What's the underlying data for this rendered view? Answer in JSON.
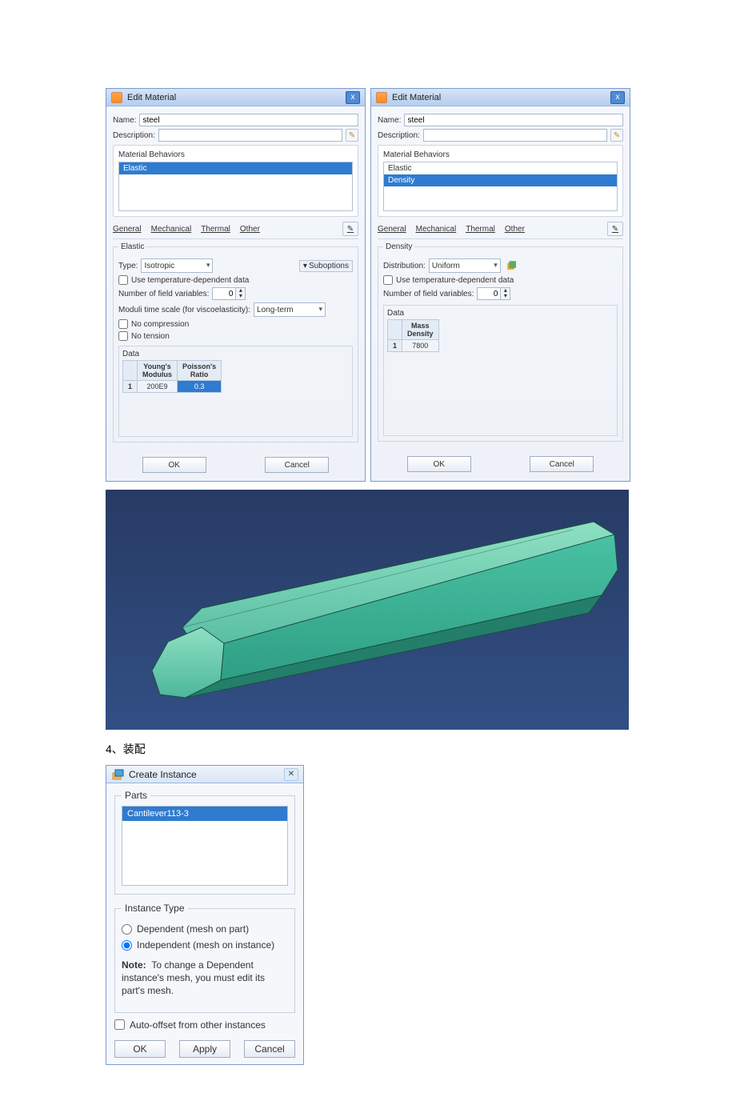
{
  "dlg_left": {
    "title": "Edit Material",
    "name_label": "Name:",
    "name_value": "steel",
    "desc_label": "Description:",
    "desc_value": "",
    "behaviors_label": "Material Behaviors",
    "behaviors": [
      "Elastic"
    ],
    "tabs": [
      "General",
      "Mechanical",
      "Thermal",
      "Other"
    ],
    "section_title": "Elastic",
    "type_label": "Type:",
    "type_value": "Isotropic",
    "suboptions_label": "Suboptions",
    "temp_dep_label": "Use temperature-dependent data",
    "field_vars_label": "Number of field variables:",
    "field_vars_value": "0",
    "moduli_label": "Moduli time scale (for viscoelasticity):",
    "moduli_value": "Long-term",
    "no_compression_label": "No compression",
    "no_tension_label": "No tension",
    "data_label": "Data",
    "table": {
      "headers": [
        "Young's\nModulus",
        "Poisson's\nRatio"
      ],
      "rows": [
        [
          "1",
          "200E9",
          "0.3"
        ]
      ]
    },
    "ok": "OK",
    "cancel": "Cancel"
  },
  "dlg_right": {
    "title": "Edit Material",
    "name_label": "Name:",
    "name_value": "steel",
    "desc_label": "Description:",
    "desc_value": "",
    "behaviors_label": "Material Behaviors",
    "behaviors": [
      "Elastic",
      "Density"
    ],
    "tabs": [
      "General",
      "Mechanical",
      "Thermal",
      "Other"
    ],
    "section_title": "Density",
    "dist_label": "Distribution:",
    "dist_value": "Uniform",
    "temp_dep_label": "Use temperature-dependent data",
    "field_vars_label": "Number of field variables:",
    "field_vars_value": "0",
    "data_label": "Data",
    "table": {
      "headers": [
        "Mass\nDensity"
      ],
      "rows": [
        [
          "1",
          "7800"
        ]
      ]
    },
    "ok": "OK",
    "cancel": "Cancel"
  },
  "heading": "4、装配",
  "create_instance": {
    "title": "Create Instance",
    "parts_label": "Parts",
    "parts": [
      "Cantilever113-3"
    ],
    "instance_type_label": "Instance Type",
    "opt_dep": "Dependent (mesh on part)",
    "opt_indep": "Independent (mesh on instance)",
    "note_bold": "Note:",
    "note_text": "To change a Dependent instance's mesh, you must edit its part's mesh.",
    "auto_offset_label": "Auto-offset from other instances",
    "ok": "OK",
    "apply": "Apply",
    "cancel": "Cancel",
    "selected_option": "independent"
  }
}
